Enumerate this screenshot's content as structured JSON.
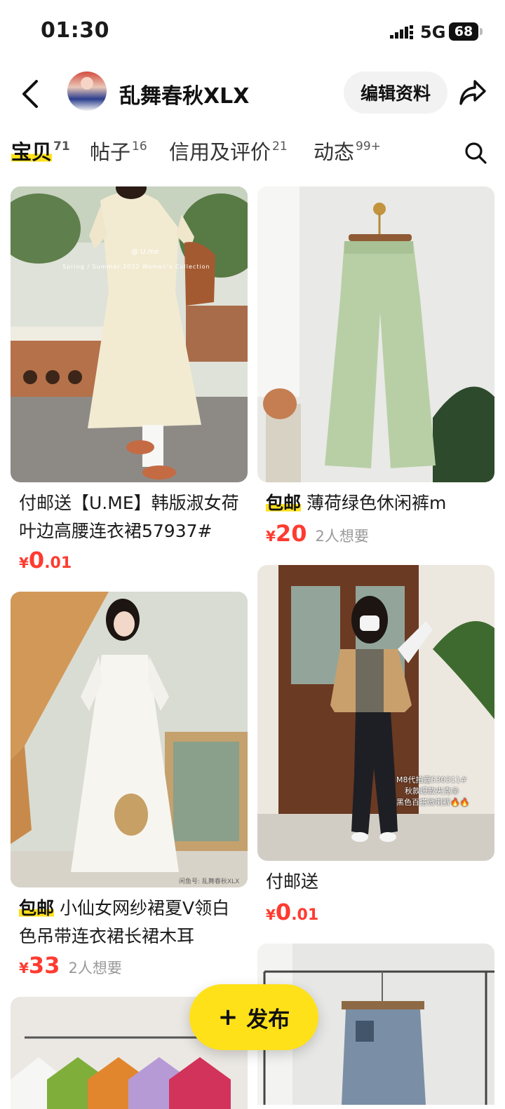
{
  "status_bar": {
    "time": "01:30",
    "network": "5G",
    "battery": "68"
  },
  "header": {
    "username": "乱舞春秋XLX",
    "edit_label": "编辑资料"
  },
  "tabs": [
    {
      "label": "宝贝",
      "count": "71"
    },
    {
      "label": "帖子",
      "count": "16"
    },
    {
      "label": "信用及评价",
      "count": "21"
    },
    {
      "label": "动态",
      "count": "99+"
    }
  ],
  "items": [
    {
      "badge": "",
      "title": "付邮送【U.ME】韩版淑女荷叶边高腰连衣裙57937#",
      "price_int": "0",
      "price_dec": ".01",
      "want": "",
      "image_text": {
        "brand": "@ U.me",
        "collection": "Spring / Summer 2022 Women's Collection"
      }
    },
    {
      "badge": "包邮",
      "title": "薄荷绿色休闲裤m",
      "price_int": "20",
      "price_dec": "",
      "want": "2人想要"
    },
    {
      "badge": "",
      "title": "付邮送",
      "price_int": "0",
      "price_dec": ".01",
      "want": "",
      "image_text": {
        "line1": "M8代拍嘉530311#",
        "line2": "秋款爆款夹克😝",
        "line3": "黑色百搭微喇裤🔥🔥"
      }
    },
    {
      "badge": "包邮",
      "title": "小仙女网纱裙夏V领白色吊带连衣裙长裙木耳",
      "price_int": "33",
      "price_dec": "",
      "want": "2人想要",
      "image_text": {
        "watermark": "闲鱼号: 乱舞春秋XLX"
      }
    }
  ],
  "currency": "¥",
  "fab": {
    "label": "发布"
  },
  "colors": {
    "accent": "#ffe11a",
    "price": "#ff3b30"
  }
}
